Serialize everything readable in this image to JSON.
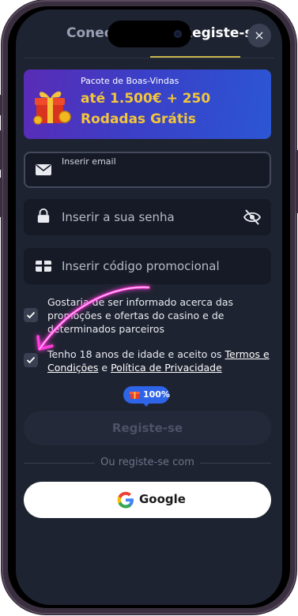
{
  "tabs": {
    "login": "Conect",
    "register": "Registe-se"
  },
  "close_icon": "×",
  "banner": {
    "subtitle": "Pacote de Boas-Vindas",
    "title": "até 1.500€ + 250 Rodadas Grátis",
    "gift_icon": "gift-icon"
  },
  "fields": {
    "email": {
      "label": "Inserir email",
      "icon": "envelope-icon"
    },
    "password": {
      "label": "Inserir a sua senha",
      "icon": "lock-icon",
      "toggle_icon": "eye-slash-icon"
    },
    "promo": {
      "label": "Inserir código promocional",
      "icon": "gift-card-icon"
    }
  },
  "consents": {
    "marketing": {
      "text": "Gostaria de ser informado acerca das promoções e ofertas do casino e de determinados parceiros",
      "checked": true
    },
    "terms": {
      "prefix": "Tenho 18 anos de idade e aceito os ",
      "terms_link": "Termos e Condições",
      "and": " e ",
      "privacy_link": "Política de Privacidade",
      "checked": true
    }
  },
  "progress": {
    "label": "100%",
    "value": 1.0
  },
  "submit_label": "Registe-se",
  "or_text": "Ou registe-se com",
  "google_label": "Google",
  "colors": {
    "accent": "#c9b34a",
    "banner_gold": "#f2c63a",
    "pill_blue": "#2e64e8",
    "arrow_pink": "#ff3cdc"
  }
}
